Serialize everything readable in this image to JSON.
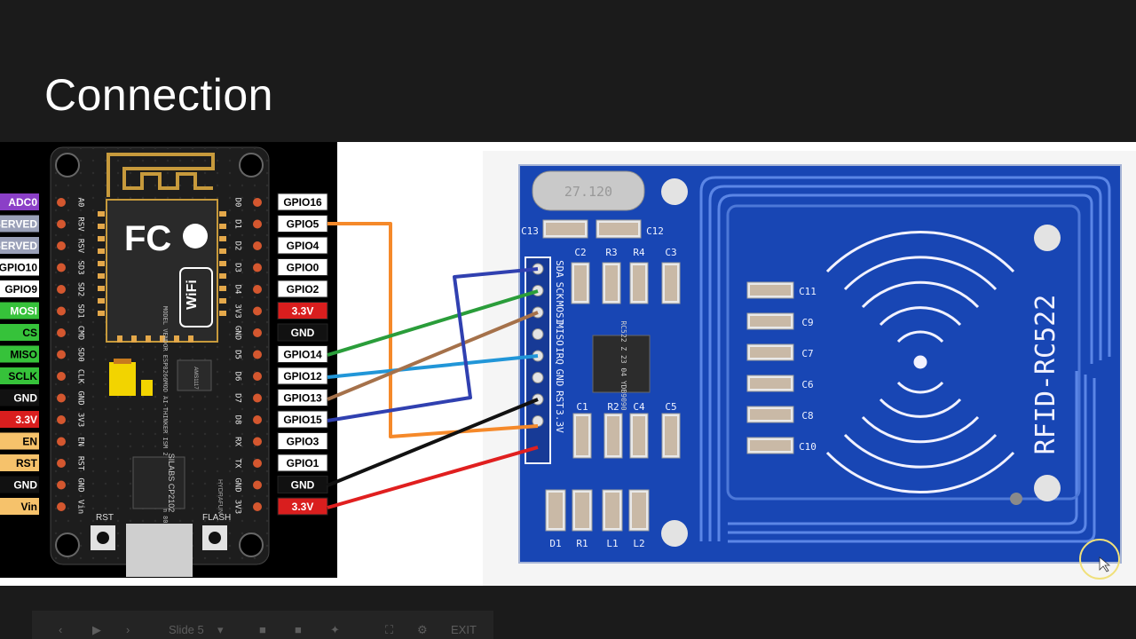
{
  "slide": {
    "title": "Connection"
  },
  "nodemcu": {
    "left_pins": [
      {
        "label": "ADC0",
        "color": "#8b3fc7",
        "text_color": "#ffffff"
      },
      {
        "label": "RESERVED",
        "color": "#9aa0b8",
        "text_color": "#ffffff"
      },
      {
        "label": "RESERVED",
        "color": "#9aa0b8",
        "text_color": "#ffffff"
      },
      {
        "label": "GPIO10",
        "color": "#ffffff",
        "text_color": "#000000"
      },
      {
        "label": "GPIO9",
        "color": "#ffffff",
        "text_color": "#000000"
      },
      {
        "label": "MOSI",
        "color": "#36c23a",
        "text_color": "#ffffff"
      },
      {
        "label": "CS",
        "color": "#36c23a",
        "text_color": "#000000"
      },
      {
        "label": "MISO",
        "color": "#36c23a",
        "text_color": "#000000"
      },
      {
        "label": "SCLK",
        "color": "#36c23a",
        "text_color": "#000000"
      },
      {
        "label": "GND",
        "color": "#111111",
        "text_color": "#ffffff"
      },
      {
        "label": "3.3V",
        "color": "#d91e1e",
        "text_color": "#ffffff"
      },
      {
        "label": "EN",
        "color": "#f6c26b",
        "text_color": "#000000"
      },
      {
        "label": "RST",
        "color": "#f6c26b",
        "text_color": "#000000"
      },
      {
        "label": "GND",
        "color": "#111111",
        "text_color": "#ffffff"
      },
      {
        "label": "Vin",
        "color": "#f6c26b",
        "text_color": "#000000"
      }
    ],
    "right_pins": [
      {
        "label": "GPIO16",
        "color": "#ffffff",
        "text_color": "#000000"
      },
      {
        "label": "GPIO5",
        "color": "#ffffff",
        "text_color": "#000000"
      },
      {
        "label": "GPIO4",
        "color": "#ffffff",
        "text_color": "#000000"
      },
      {
        "label": "GPIO0",
        "color": "#ffffff",
        "text_color": "#000000"
      },
      {
        "label": "GPIO2",
        "color": "#ffffff",
        "text_color": "#000000"
      },
      {
        "label": "3.3V",
        "color": "#d91e1e",
        "text_color": "#ffffff"
      },
      {
        "label": "GND",
        "color": "#111111",
        "text_color": "#ffffff"
      },
      {
        "label": "GPIO14",
        "color": "#ffffff",
        "text_color": "#000000"
      },
      {
        "label": "GPIO12",
        "color": "#ffffff",
        "text_color": "#000000"
      },
      {
        "label": "GPIO13",
        "color": "#ffffff",
        "text_color": "#000000"
      },
      {
        "label": "GPIO15",
        "color": "#ffffff",
        "text_color": "#000000"
      },
      {
        "label": "GPIO3",
        "color": "#ffffff",
        "text_color": "#000000"
      },
      {
        "label": "GPIO1",
        "color": "#ffffff",
        "text_color": "#000000"
      },
      {
        "label": "GND",
        "color": "#111111",
        "text_color": "#ffffff"
      },
      {
        "label": "3.3V",
        "color": "#d91e1e",
        "text_color": "#ffffff"
      }
    ],
    "left_silk": [
      "A0",
      "RSV",
      "RSV",
      "SD3",
      "SD2",
      "SD1",
      "CMD",
      "SD0",
      "CLK",
      "GND",
      "3V3",
      "EN",
      "RST",
      "GND",
      "Vin"
    ],
    "right_silk": [
      "D0",
      "D1",
      "D2",
      "D3",
      "D4",
      "3V3",
      "GND",
      "D5",
      "D6",
      "D7",
      "D8",
      "RX",
      "TX",
      "GND",
      "3V3"
    ],
    "module_text": "MODEL VENDOR ESP8266MOD AI-THINKER ISM 2.4GHz PA +25dBm 802.11b/g/n",
    "wifi_text": "WiFi",
    "fcc_text": "FC",
    "chip_label": "SILABS CP2102",
    "regulator_label": "AMS1117",
    "brand_label": "HYDRAFUN",
    "rst_button": "RST",
    "flash_button": "FLASH"
  },
  "rfid": {
    "board_label": "RFID-RC522",
    "chip_label": "RC522 Z 23 04 YDB9090",
    "crystal_label": "27.120",
    "pin_labels": [
      "SDA",
      "SCK",
      "MOSI",
      "MISO",
      "IRQ",
      "GND",
      "RST",
      "3.3V"
    ],
    "top_components": [
      "C13",
      "C12",
      "C2",
      "R3",
      "R4",
      "C3"
    ],
    "bottom_components": [
      "C1",
      "R2",
      "C4",
      "C5"
    ],
    "corner_components": [
      "D1",
      "R1",
      "L1",
      "L2"
    ],
    "capacitor_column": [
      "C11",
      "C9",
      "C7",
      "C6",
      "C8",
      "C10"
    ]
  },
  "wires": [
    {
      "from": "GPIO5",
      "to": "RST",
      "color": "#f5892a"
    },
    {
      "from": "GPIO14",
      "to": "SCK",
      "color": "#2a9d3a"
    },
    {
      "from": "GPIO12",
      "to": "MISO",
      "color": "#2196d8"
    },
    {
      "from": "GPIO13",
      "to": "MOSI",
      "color": "#a5714a"
    },
    {
      "from": "GPIO15",
      "to": "SDA",
      "color": "#3040b0"
    },
    {
      "from": "GND",
      "to": "GND",
      "color": "#111111"
    },
    {
      "from": "3.3V",
      "to": "3.3V",
      "color": "#e01f1f"
    }
  ],
  "presenter_bar": {
    "slide_label": "Slide 5",
    "exit_label": "EXIT"
  },
  "colors": {
    "background": "#1b1b1b",
    "board_blue": "#1846b4",
    "pcb_black": "#1d1d1d"
  }
}
